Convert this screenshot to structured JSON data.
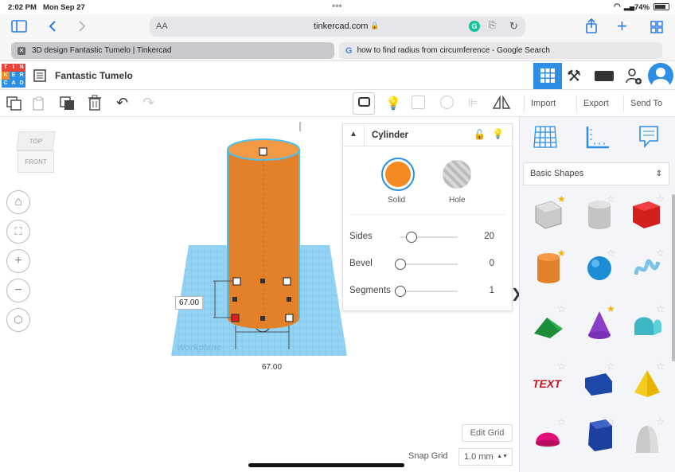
{
  "status_bar": {
    "time": "2:02 PM",
    "date": "Mon Sep 27",
    "battery": "74%"
  },
  "safari": {
    "text_size": "AA",
    "url": "tinkercad.com"
  },
  "tabs": [
    {
      "title": "3D design Fantastic Tumelo | Tinkercad"
    },
    {
      "title": "how to find radius from circumference - Google Search"
    }
  ],
  "logo": {
    "letters": [
      "T",
      "I",
      "N",
      "K",
      "E",
      "R",
      "C",
      "A",
      "D"
    ]
  },
  "app": {
    "design_name": "Fantastic Tumelo"
  },
  "toolbar": {
    "import_label": "Import",
    "export_label": "Export",
    "send_to_label": "Send To"
  },
  "view_cube": {
    "top_label": "TOP",
    "front_label": "FRONT"
  },
  "dimensions": {
    "height_value": "67.00",
    "width_value": "67.00",
    "workplane_label": "Workplane"
  },
  "inspector": {
    "title": "Cylinder",
    "solid_label": "Solid",
    "hole_label": "Hole",
    "solid_color": "#f28a21",
    "properties": [
      {
        "label": "Sides",
        "value": "20",
        "level": 0.2
      },
      {
        "label": "Bevel",
        "value": "0",
        "level": 0
      },
      {
        "label": "Segments",
        "value": "1",
        "level": 0
      }
    ]
  },
  "library": {
    "category": "Basic Shapes",
    "shapes": [
      {
        "name": "Box Hole",
        "starred": true
      },
      {
        "name": "Cylinder Hole",
        "starred": false
      },
      {
        "name": "Box",
        "starred": false
      },
      {
        "name": "Cylinder",
        "starred": true
      },
      {
        "name": "Sphere",
        "starred": false
      },
      {
        "name": "Scribble",
        "starred": false
      },
      {
        "name": "Roof",
        "starred": false
      },
      {
        "name": "Cone",
        "starred": true
      },
      {
        "name": "Round Roof",
        "starred": false
      },
      {
        "name": "Text",
        "starred": false
      },
      {
        "name": "Wedge",
        "starred": false
      },
      {
        "name": "Pyramid",
        "starred": false
      },
      {
        "name": "Half Sphere",
        "starred": false
      },
      {
        "name": "Polygon",
        "starred": false
      },
      {
        "name": "Paraboloid",
        "starred": false
      }
    ]
  },
  "grid": {
    "edit_grid_label": "Edit Grid",
    "snap_grid_label": "Snap Grid",
    "snap_value": "1.0 mm"
  },
  "colors": {
    "accent_blue": "#2c8fe5",
    "tinker_orange": "#f28a21",
    "workplane_blue": "#8fd0f0"
  }
}
